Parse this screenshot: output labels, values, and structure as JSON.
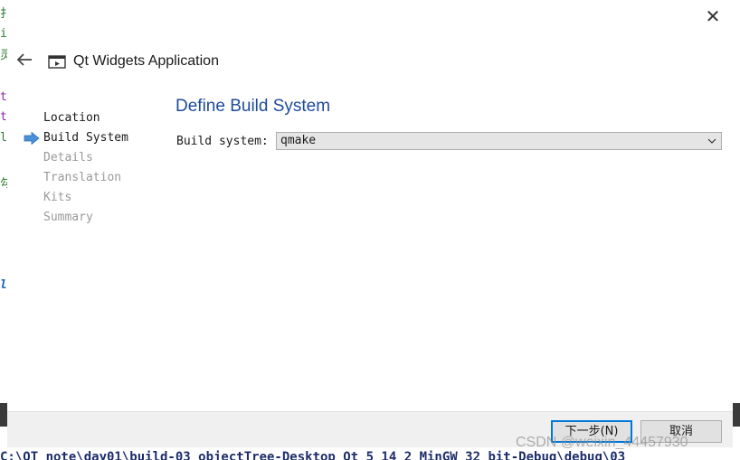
{
  "background": {
    "left_fragments": [
      {
        "text": "扌",
        "color": "#2e7d32"
      },
      {
        "text": "i",
        "color": "#2e7d32"
      },
      {
        "text": "灵",
        "color": "#2e7d32"
      },
      {
        "text": "t",
        "color": "#8e24aa"
      },
      {
        "text": "t",
        "color": "#8e24aa"
      },
      {
        "text": "le",
        "color": "#2e7d32"
      },
      {
        "text": "勾",
        "color": "#2e7d32"
      },
      {
        "text": "le",
        "color": "#1565c0"
      }
    ],
    "bottom_path": "C:\\QT_note\\day01\\build-03_objectTree-Desktop_Qt_5_14_2_MinGW_32_bit-Debug\\debug\\03"
  },
  "dialog": {
    "close_label": "✕",
    "header_title": "Qt Widgets Application",
    "steps": [
      {
        "label": "Location",
        "state": "done"
      },
      {
        "label": "Build System",
        "state": "current"
      },
      {
        "label": "Details",
        "state": "pending"
      },
      {
        "label": "Translation",
        "state": "pending"
      },
      {
        "label": "Kits",
        "state": "pending"
      },
      {
        "label": "Summary",
        "state": "pending"
      }
    ],
    "page_title": "Define Build System",
    "build_system_label": "Build system:",
    "build_system_value": "qmake",
    "next_label": "下一步(N)",
    "cancel_label": "取消"
  },
  "watermark": "CSDN @weixin_44457930",
  "colors": {
    "title_blue": "#1f4a9c",
    "arrow_blue": "#4a90d9",
    "focus_blue": "#0078d7"
  }
}
